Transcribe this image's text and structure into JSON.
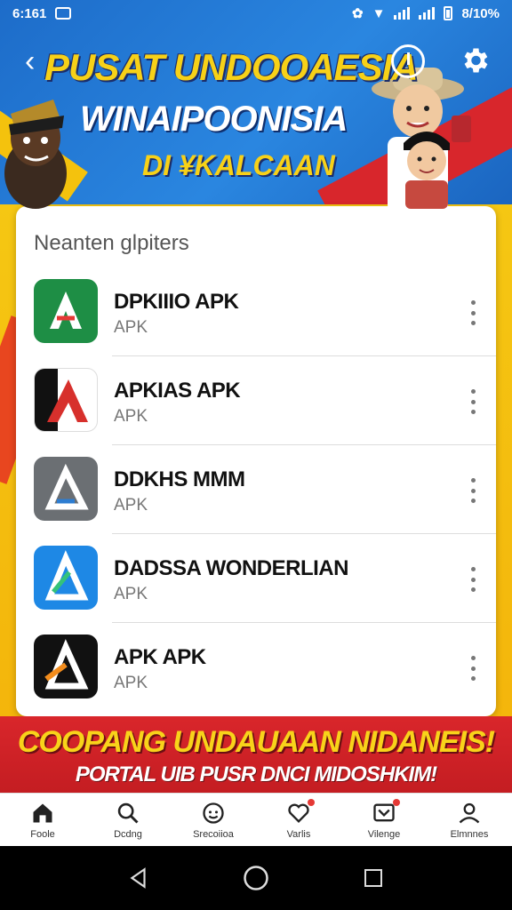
{
  "status_bar": {
    "time": "6:161",
    "battery": "8/10%"
  },
  "banner": {
    "title": "PUSAT UNDOOAESIA",
    "subtitle": "WINAIPOONISIA",
    "subtitle2": "DI ¥KALCAAN"
  },
  "card": {
    "header": "Neanten glpiters",
    "apps": [
      {
        "name": "DPKIIIO APK",
        "type": "APK",
        "icon_bg": "#1e8e45",
        "icon_fg": "#ffffff"
      },
      {
        "name": "APKIAS APK",
        "type": "APK",
        "icon_bg": "#ffffff",
        "icon_fg": "#d7302c"
      },
      {
        "name": "DDKHS MMM",
        "type": "APK",
        "icon_bg": "#6b6f73",
        "icon_fg": "#ffffff"
      },
      {
        "name": "DADSSA WONDERLIAN",
        "type": "APK",
        "icon_bg": "#1e88e5",
        "icon_fg": "#ffffff"
      },
      {
        "name": "APK APK",
        "type": "APK",
        "icon_bg": "#111111",
        "icon_fg": "#ffffff"
      }
    ]
  },
  "promo": {
    "title": "COOPANG UNDAUAAN NIDANEIS!",
    "subtitle": "PORTAL UIB PUSR DNCI MIDOSHKIM!"
  },
  "bottom_nav": [
    {
      "label": "Foole",
      "icon": "home-icon"
    },
    {
      "label": "Dcdng",
      "icon": "search-icon"
    },
    {
      "label": "Srecoiioa",
      "icon": "compass-icon"
    },
    {
      "label": "Varlis",
      "icon": "heart-icon"
    },
    {
      "label": "Vilenge",
      "icon": "inbox-icon"
    },
    {
      "label": "Elmnnes",
      "icon": "profile-icon"
    }
  ],
  "colors": {
    "accent_yellow": "#f5c713",
    "accent_red": "#d9262b",
    "banner_blue": "#1d6cc9"
  }
}
